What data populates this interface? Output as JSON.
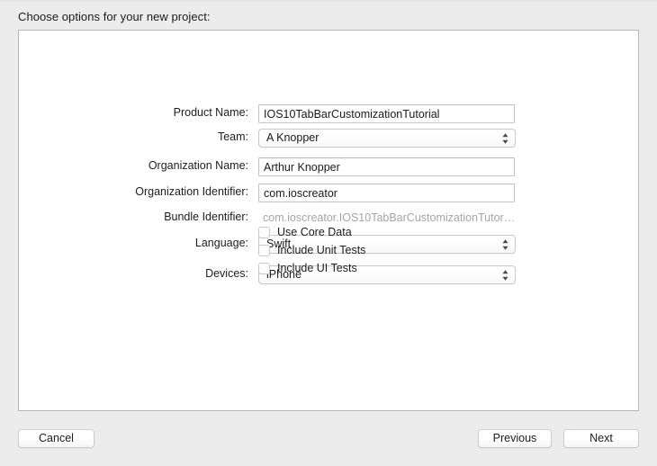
{
  "sheet": {
    "title": "Choose options for your new project:"
  },
  "form": {
    "rows": [
      {
        "label": "Product Name:",
        "type": "textfield",
        "value": "IOS10TabBarCustomizationTutorial",
        "name": "product-name"
      },
      {
        "label": "Team:",
        "type": "popup",
        "value": "A Knopper",
        "name": "team"
      },
      {
        "label": "Organization Name:",
        "type": "textfield",
        "value": "Arthur Knopper",
        "name": "organization-name"
      },
      {
        "label": "Organization Identifier:",
        "type": "textfield",
        "value": "com.ioscreator",
        "name": "organization-identifier"
      },
      {
        "label": "Bundle Identifier:",
        "type": "static",
        "value": "com.ioscreator.IOS10TabBarCustomizationTutor…",
        "name": "bundle-identifier"
      },
      {
        "label": "Language:",
        "type": "popup",
        "value": "Swift",
        "name": "language"
      },
      {
        "label": "Devices:",
        "type": "popup",
        "value": "iPhone",
        "name": "devices"
      }
    ],
    "checkboxes": [
      {
        "label": "Use Core Data",
        "checked": false,
        "name": "use-core-data"
      },
      {
        "label": "Include Unit Tests",
        "checked": false,
        "name": "include-unit-tests"
      },
      {
        "label": "Include UI Tests",
        "checked": false,
        "name": "include-ui-tests"
      }
    ]
  },
  "footer": {
    "cancel_label": "Cancel",
    "previous_label": "Previous",
    "next_label": "Next"
  },
  "icons": {
    "stepper": "up-down-chevron-icon"
  },
  "colors": {
    "window_background": "#ececec",
    "panel_background": "#ffffff",
    "panel_border": "#b6b6b6",
    "text_primary": "#1c1c1c",
    "text_disabled": "#a5a5a5",
    "field_border": "#c5c5c5"
  }
}
